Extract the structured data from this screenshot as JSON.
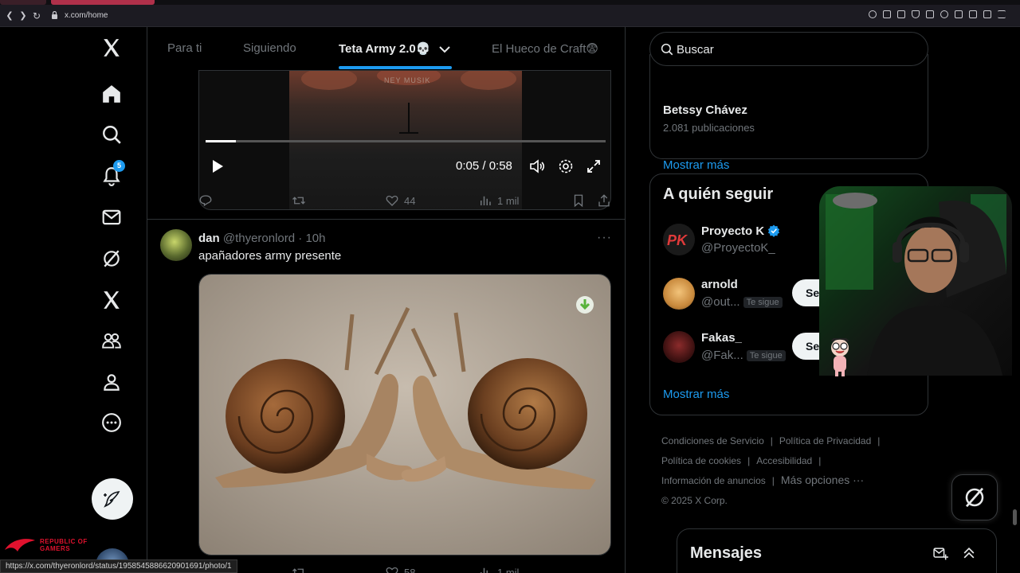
{
  "browser": {
    "url": "x.com/home",
    "status_url": "https://x.com/thyeronlord/status/1958545886620901691/photo/1"
  },
  "left_nav": {
    "notifications_badge": "5",
    "icons": [
      "x-logo-icon",
      "home-icon",
      "search-icon",
      "bell-icon",
      "mail-icon",
      "grok-icon",
      "x-premium-icon",
      "communities-icon",
      "profile-icon",
      "more-icon"
    ],
    "overlay_brand_line1": "REPUBLIC OF",
    "overlay_brand_line2": "GAMERS"
  },
  "tabs": {
    "items": [
      "Para ti",
      "Siguiendo",
      "Teta Army 2.0💀",
      "El Hueco de Craft😨"
    ],
    "active_index": 2
  },
  "video": {
    "watermark": "NEY MUSIK",
    "time": "0:05 / 0:58",
    "progress": 0.076
  },
  "video_actions": {
    "likes": "44",
    "views": "1 mil"
  },
  "tweet": {
    "name": "dan",
    "handle": "@thyeronlord · 10h",
    "text": "apañadores army presente",
    "likes": "58",
    "views": "1 mil"
  },
  "search": {
    "placeholder": "Buscar"
  },
  "trend": {
    "name": "Betssy Chávez",
    "count": "2.081 publicaciones",
    "show_more": "Mostrar más"
  },
  "who_to_follow": {
    "title": "A quién seguir",
    "accounts": [
      {
        "name": "Proyecto K",
        "handle": "@ProyectoK_",
        "verified": true,
        "follows_you": "",
        "button": ""
      },
      {
        "name": "arnold",
        "handle": "@out...",
        "verified": false,
        "follows_you": "Te sigue",
        "button": "Se"
      },
      {
        "name": "Fakas_",
        "handle": "@Fak...",
        "verified": false,
        "follows_you": "Te sigue",
        "button": "Se"
      }
    ],
    "show_more": "Mostrar más"
  },
  "footer": {
    "links": [
      "Condiciones de Servicio",
      "Política de Privacidad",
      "Política de cookies",
      "Accesibilidad",
      "Información de anuncios",
      "Más opciones ···"
    ],
    "copyright": "© 2025 X Corp."
  },
  "messages": {
    "title": "Mensajes"
  },
  "colors": {
    "accent": "#1d9bf0",
    "background": "#000000",
    "border": "#2f3336",
    "text_secondary": "#71767b"
  }
}
